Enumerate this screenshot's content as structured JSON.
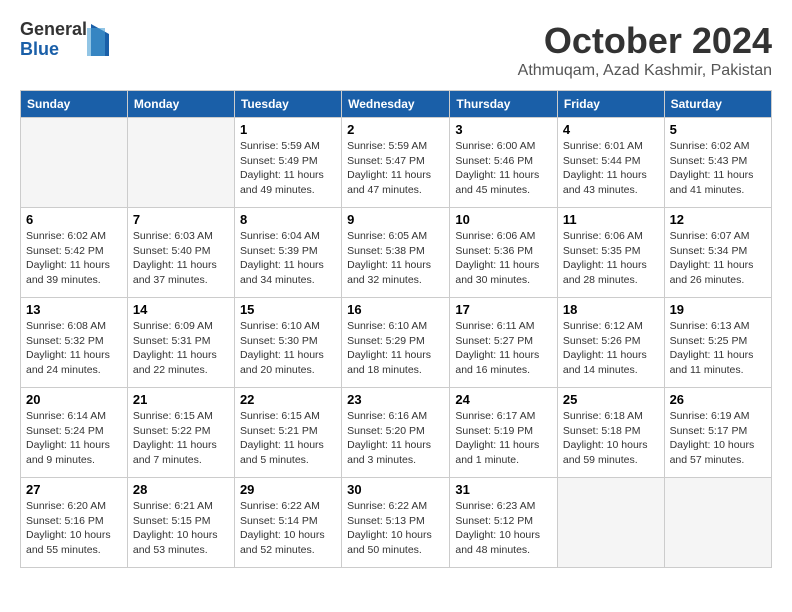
{
  "logo": {
    "general": "General",
    "blue": "Blue"
  },
  "title": {
    "month": "October 2024",
    "location": "Athmuqam, Azad Kashmir, Pakistan"
  },
  "headers": [
    "Sunday",
    "Monday",
    "Tuesday",
    "Wednesday",
    "Thursday",
    "Friday",
    "Saturday"
  ],
  "weeks": [
    [
      {
        "day": "",
        "info": ""
      },
      {
        "day": "",
        "info": ""
      },
      {
        "day": "1",
        "info": "Sunrise: 5:59 AM\nSunset: 5:49 PM\nDaylight: 11 hours and 49 minutes."
      },
      {
        "day": "2",
        "info": "Sunrise: 5:59 AM\nSunset: 5:47 PM\nDaylight: 11 hours and 47 minutes."
      },
      {
        "day": "3",
        "info": "Sunrise: 6:00 AM\nSunset: 5:46 PM\nDaylight: 11 hours and 45 minutes."
      },
      {
        "day": "4",
        "info": "Sunrise: 6:01 AM\nSunset: 5:44 PM\nDaylight: 11 hours and 43 minutes."
      },
      {
        "day": "5",
        "info": "Sunrise: 6:02 AM\nSunset: 5:43 PM\nDaylight: 11 hours and 41 minutes."
      }
    ],
    [
      {
        "day": "6",
        "info": "Sunrise: 6:02 AM\nSunset: 5:42 PM\nDaylight: 11 hours and 39 minutes."
      },
      {
        "day": "7",
        "info": "Sunrise: 6:03 AM\nSunset: 5:40 PM\nDaylight: 11 hours and 37 minutes."
      },
      {
        "day": "8",
        "info": "Sunrise: 6:04 AM\nSunset: 5:39 PM\nDaylight: 11 hours and 34 minutes."
      },
      {
        "day": "9",
        "info": "Sunrise: 6:05 AM\nSunset: 5:38 PM\nDaylight: 11 hours and 32 minutes."
      },
      {
        "day": "10",
        "info": "Sunrise: 6:06 AM\nSunset: 5:36 PM\nDaylight: 11 hours and 30 minutes."
      },
      {
        "day": "11",
        "info": "Sunrise: 6:06 AM\nSunset: 5:35 PM\nDaylight: 11 hours and 28 minutes."
      },
      {
        "day": "12",
        "info": "Sunrise: 6:07 AM\nSunset: 5:34 PM\nDaylight: 11 hours and 26 minutes."
      }
    ],
    [
      {
        "day": "13",
        "info": "Sunrise: 6:08 AM\nSunset: 5:32 PM\nDaylight: 11 hours and 24 minutes."
      },
      {
        "day": "14",
        "info": "Sunrise: 6:09 AM\nSunset: 5:31 PM\nDaylight: 11 hours and 22 minutes."
      },
      {
        "day": "15",
        "info": "Sunrise: 6:10 AM\nSunset: 5:30 PM\nDaylight: 11 hours and 20 minutes."
      },
      {
        "day": "16",
        "info": "Sunrise: 6:10 AM\nSunset: 5:29 PM\nDaylight: 11 hours and 18 minutes."
      },
      {
        "day": "17",
        "info": "Sunrise: 6:11 AM\nSunset: 5:27 PM\nDaylight: 11 hours and 16 minutes."
      },
      {
        "day": "18",
        "info": "Sunrise: 6:12 AM\nSunset: 5:26 PM\nDaylight: 11 hours and 14 minutes."
      },
      {
        "day": "19",
        "info": "Sunrise: 6:13 AM\nSunset: 5:25 PM\nDaylight: 11 hours and 11 minutes."
      }
    ],
    [
      {
        "day": "20",
        "info": "Sunrise: 6:14 AM\nSunset: 5:24 PM\nDaylight: 11 hours and 9 minutes."
      },
      {
        "day": "21",
        "info": "Sunrise: 6:15 AM\nSunset: 5:22 PM\nDaylight: 11 hours and 7 minutes."
      },
      {
        "day": "22",
        "info": "Sunrise: 6:15 AM\nSunset: 5:21 PM\nDaylight: 11 hours and 5 minutes."
      },
      {
        "day": "23",
        "info": "Sunrise: 6:16 AM\nSunset: 5:20 PM\nDaylight: 11 hours and 3 minutes."
      },
      {
        "day": "24",
        "info": "Sunrise: 6:17 AM\nSunset: 5:19 PM\nDaylight: 11 hours and 1 minute."
      },
      {
        "day": "25",
        "info": "Sunrise: 6:18 AM\nSunset: 5:18 PM\nDaylight: 10 hours and 59 minutes."
      },
      {
        "day": "26",
        "info": "Sunrise: 6:19 AM\nSunset: 5:17 PM\nDaylight: 10 hours and 57 minutes."
      }
    ],
    [
      {
        "day": "27",
        "info": "Sunrise: 6:20 AM\nSunset: 5:16 PM\nDaylight: 10 hours and 55 minutes."
      },
      {
        "day": "28",
        "info": "Sunrise: 6:21 AM\nSunset: 5:15 PM\nDaylight: 10 hours and 53 minutes."
      },
      {
        "day": "29",
        "info": "Sunrise: 6:22 AM\nSunset: 5:14 PM\nDaylight: 10 hours and 52 minutes."
      },
      {
        "day": "30",
        "info": "Sunrise: 6:22 AM\nSunset: 5:13 PM\nDaylight: 10 hours and 50 minutes."
      },
      {
        "day": "31",
        "info": "Sunrise: 6:23 AM\nSunset: 5:12 PM\nDaylight: 10 hours and 48 minutes."
      },
      {
        "day": "",
        "info": ""
      },
      {
        "day": "",
        "info": ""
      }
    ]
  ]
}
